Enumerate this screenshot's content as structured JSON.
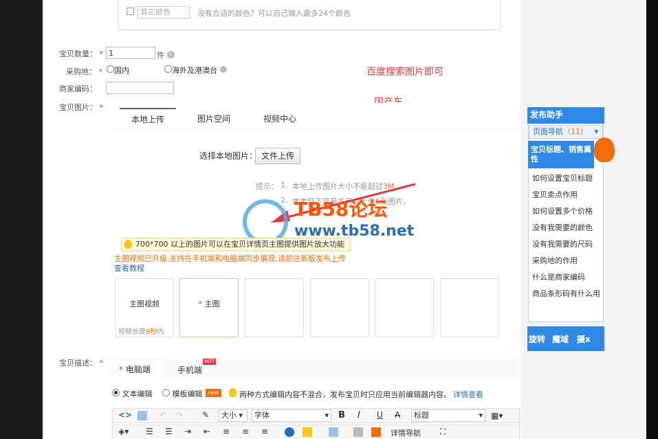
{
  "color_section": {
    "other_color_placeholder": "其它颜色",
    "hint": "没有合适的颜色？可以自己输入最多24个颜色"
  },
  "quantity": {
    "label": "宝贝数量：",
    "value": "1",
    "unit": "件"
  },
  "origin": {
    "label": "采购地：",
    "option_domestic": "国内",
    "option_overseas": "海外及港澳台"
  },
  "merchant_code": {
    "label": "商家编码：",
    "value": ""
  },
  "annotations": {
    "line1": "百度搜索图片即可",
    "line2": "国产车"
  },
  "images": {
    "label": "宝贝图片：",
    "tabs": [
      "本地上传",
      "图片空间",
      "视频中心"
    ],
    "select_label": "选择本地图片：",
    "upload_button": "文件上传",
    "tip_prefix": "提示：",
    "tip1_num": "1.",
    "tip1_text": "本地上传图片大小不能超过",
    "tip1_size": "3M",
    "tip2_num": "2.",
    "tip2_text": "本类目下您最多可以上传5张图片。",
    "zoom_tip": "700*700 以上的图片可以在宝贝详情页主图提供图片放大功能",
    "video_upgrade": "主图视频已升级,支持在手机端和电脑端同步展现,请前往新版发布上传",
    "tutorial_link": "查看教程",
    "video_slot_title": "主图视频",
    "video_slot_hint_prefix": "视频长度",
    "video_slot_hint_value": "9秒",
    "video_slot_hint_suffix": "内",
    "main_slot_title": "主图"
  },
  "watermark": {
    "site": "TB58论坛",
    "url": "www.tb58.net"
  },
  "description": {
    "label": "宝贝描述：",
    "tab_pc": "电脑端",
    "tab_mobile": "手机端",
    "hot_badge": "HOT",
    "mode_text": "文本编辑",
    "mode_template": "模板编辑",
    "new_badge": "new",
    "mode_note": "两种方式编辑内容不混合，发布宝贝时只应用当前编辑器内容。",
    "detail_link": "详情查看"
  },
  "editor": {
    "font_size": "大小",
    "font_family": "字体",
    "heading": "标题",
    "bold": "B",
    "italic": "I",
    "underline": "U",
    "strike": "A",
    "nav_label": "详情导航"
  },
  "assistant": {
    "title": "发布助手",
    "nav": "页面导航",
    "nav_count": "（11）",
    "section": "宝贝标题、销售属性",
    "items": [
      "如何设置宝贝标题",
      "宝贝卖点作用",
      "如何设置多个价格",
      "没有我需要的颜色",
      "没有我需要的尺码",
      "采购地的作用",
      "什么是商家编码",
      "商品条形码有什么用"
    ],
    "footer": [
      "旋转",
      "魔域",
      "摄x"
    ]
  },
  "colors": {
    "accent_blue": "#2e8ae6",
    "required_red": "#e4393c",
    "warn_orange": "#f26c0a",
    "link_blue": "#2b6eb5"
  }
}
